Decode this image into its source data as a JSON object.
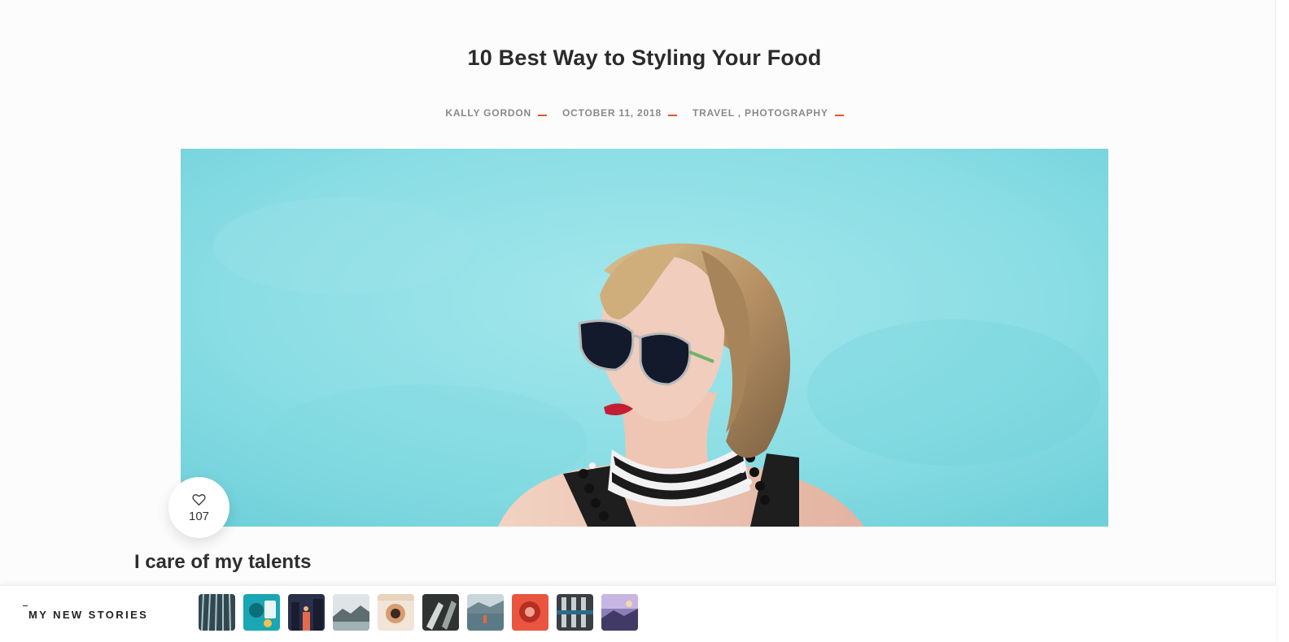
{
  "post": {
    "title": "10 Best Way to Styling Your Food",
    "meta": {
      "author": "KALLY GORDON",
      "date": "OCTOBER 11, 2018",
      "categories": "TRAVEL , PHOTOGRAPHY"
    },
    "accent_color": "#e4572e",
    "hero_image": "woman-with-sunglasses-on-turquoise-background",
    "likes": {
      "icon": "heart-icon",
      "count": "107"
    },
    "section_heading": "I care of my talents"
  },
  "stories_bar": {
    "label": "MY NEW STORIES",
    "thumbnails": [
      "story-thumb-1",
      "story-thumb-2",
      "story-thumb-3",
      "story-thumb-4",
      "story-thumb-5",
      "story-thumb-6",
      "story-thumb-7",
      "story-thumb-8",
      "story-thumb-9",
      "story-thumb-10"
    ]
  }
}
